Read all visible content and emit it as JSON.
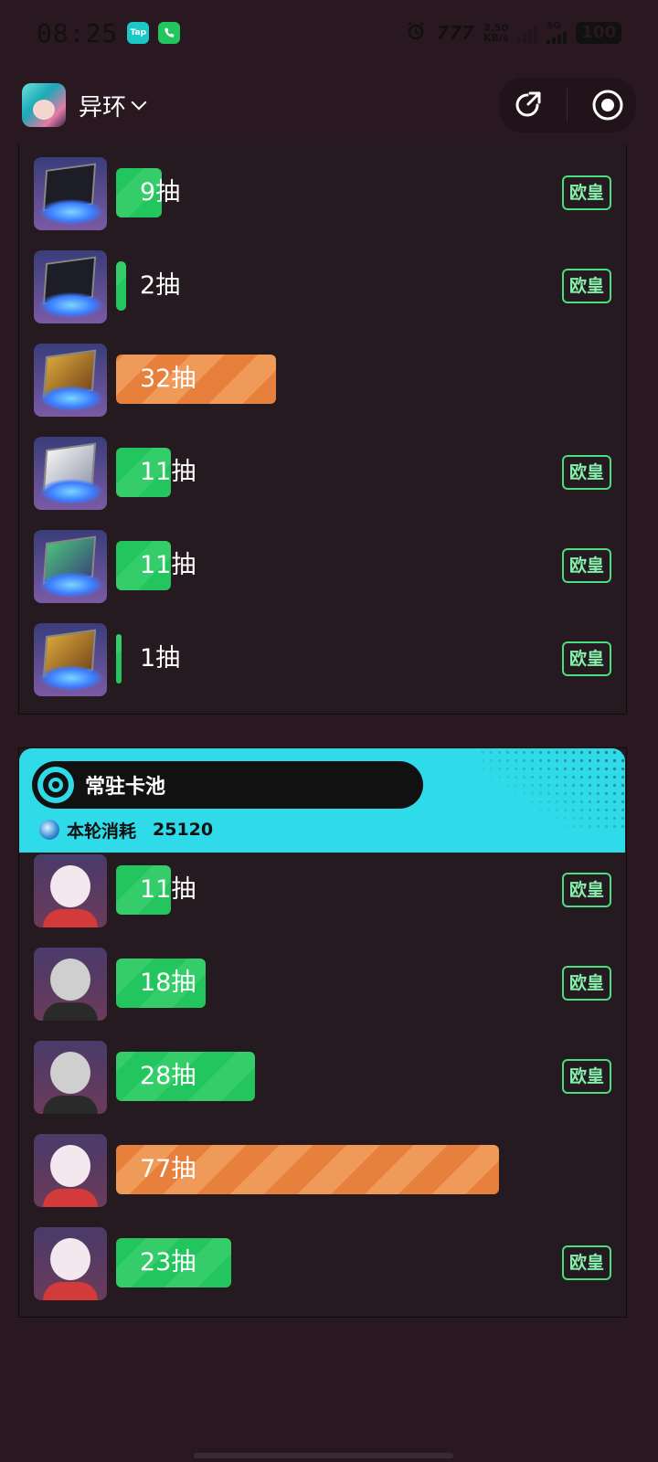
{
  "status_bar": {
    "time": "08:25",
    "net_speed_value": "3.50",
    "net_speed_unit": "KB/s",
    "network": "5G",
    "battery": "100",
    "app_icons": [
      "taptap-icon",
      "phone-icon"
    ]
  },
  "header": {
    "game_name": "异环",
    "share_icon": "share-icon",
    "target_icon": "record-target-icon"
  },
  "colors": {
    "background": "#2a1821",
    "green_bar": "#22c55e",
    "orange_bar": "#e8803d",
    "badge_green": "#4ade80",
    "pool_header": "#2fdbe8"
  },
  "top_list": {
    "rows": [
      {
        "icon": "arc-card-icon",
        "label": "9抽",
        "pulls": 9,
        "fill_fraction": 0.09,
        "color": "green",
        "badge": "欧皇"
      },
      {
        "icon": "arc-card-icon",
        "label": "2抽",
        "pulls": 2,
        "fill_fraction": 0.02,
        "color": "green",
        "badge": "欧皇"
      },
      {
        "icon": "arc-card-gold-icon",
        "label": "32抽",
        "pulls": 32,
        "fill_fraction": 0.33,
        "color": "orange",
        "badge": ""
      },
      {
        "icon": "arc-card-white-icon",
        "label": "11抽",
        "pulls": 11,
        "fill_fraction": 0.11,
        "color": "green",
        "badge": "欧皇"
      },
      {
        "icon": "arc-card-green-icon",
        "label": "11抽",
        "pulls": 11,
        "fill_fraction": 0.11,
        "color": "green",
        "badge": "欧皇"
      },
      {
        "icon": "arc-card-gold-icon",
        "label": "1抽",
        "pulls": 1,
        "fill_fraction": 0.01,
        "color": "green",
        "badge": "欧皇"
      }
    ]
  },
  "standard_pool": {
    "title": "常驻卡池",
    "cost_label": "本轮消耗",
    "cost_value": "25120",
    "rows": [
      {
        "icon": "character-avatar-red",
        "label": "11抽",
        "pulls": 11,
        "fill_fraction": 0.11,
        "color": "green",
        "badge": "欧皇"
      },
      {
        "icon": "character-avatar-grey",
        "label": "18抽",
        "pulls": 18,
        "fill_fraction": 0.18,
        "color": "green",
        "badge": "欧皇"
      },
      {
        "icon": "character-avatar-grey",
        "label": "28抽",
        "pulls": 28,
        "fill_fraction": 0.29,
        "color": "green",
        "badge": "欧皇"
      },
      {
        "icon": "character-avatar-red",
        "label": "77抽",
        "pulls": 77,
        "fill_fraction": 0.8,
        "color": "orange",
        "badge": ""
      },
      {
        "icon": "character-avatar-red",
        "label": "23抽",
        "pulls": 23,
        "fill_fraction": 0.24,
        "color": "green",
        "badge": "欧皇"
      }
    ]
  }
}
